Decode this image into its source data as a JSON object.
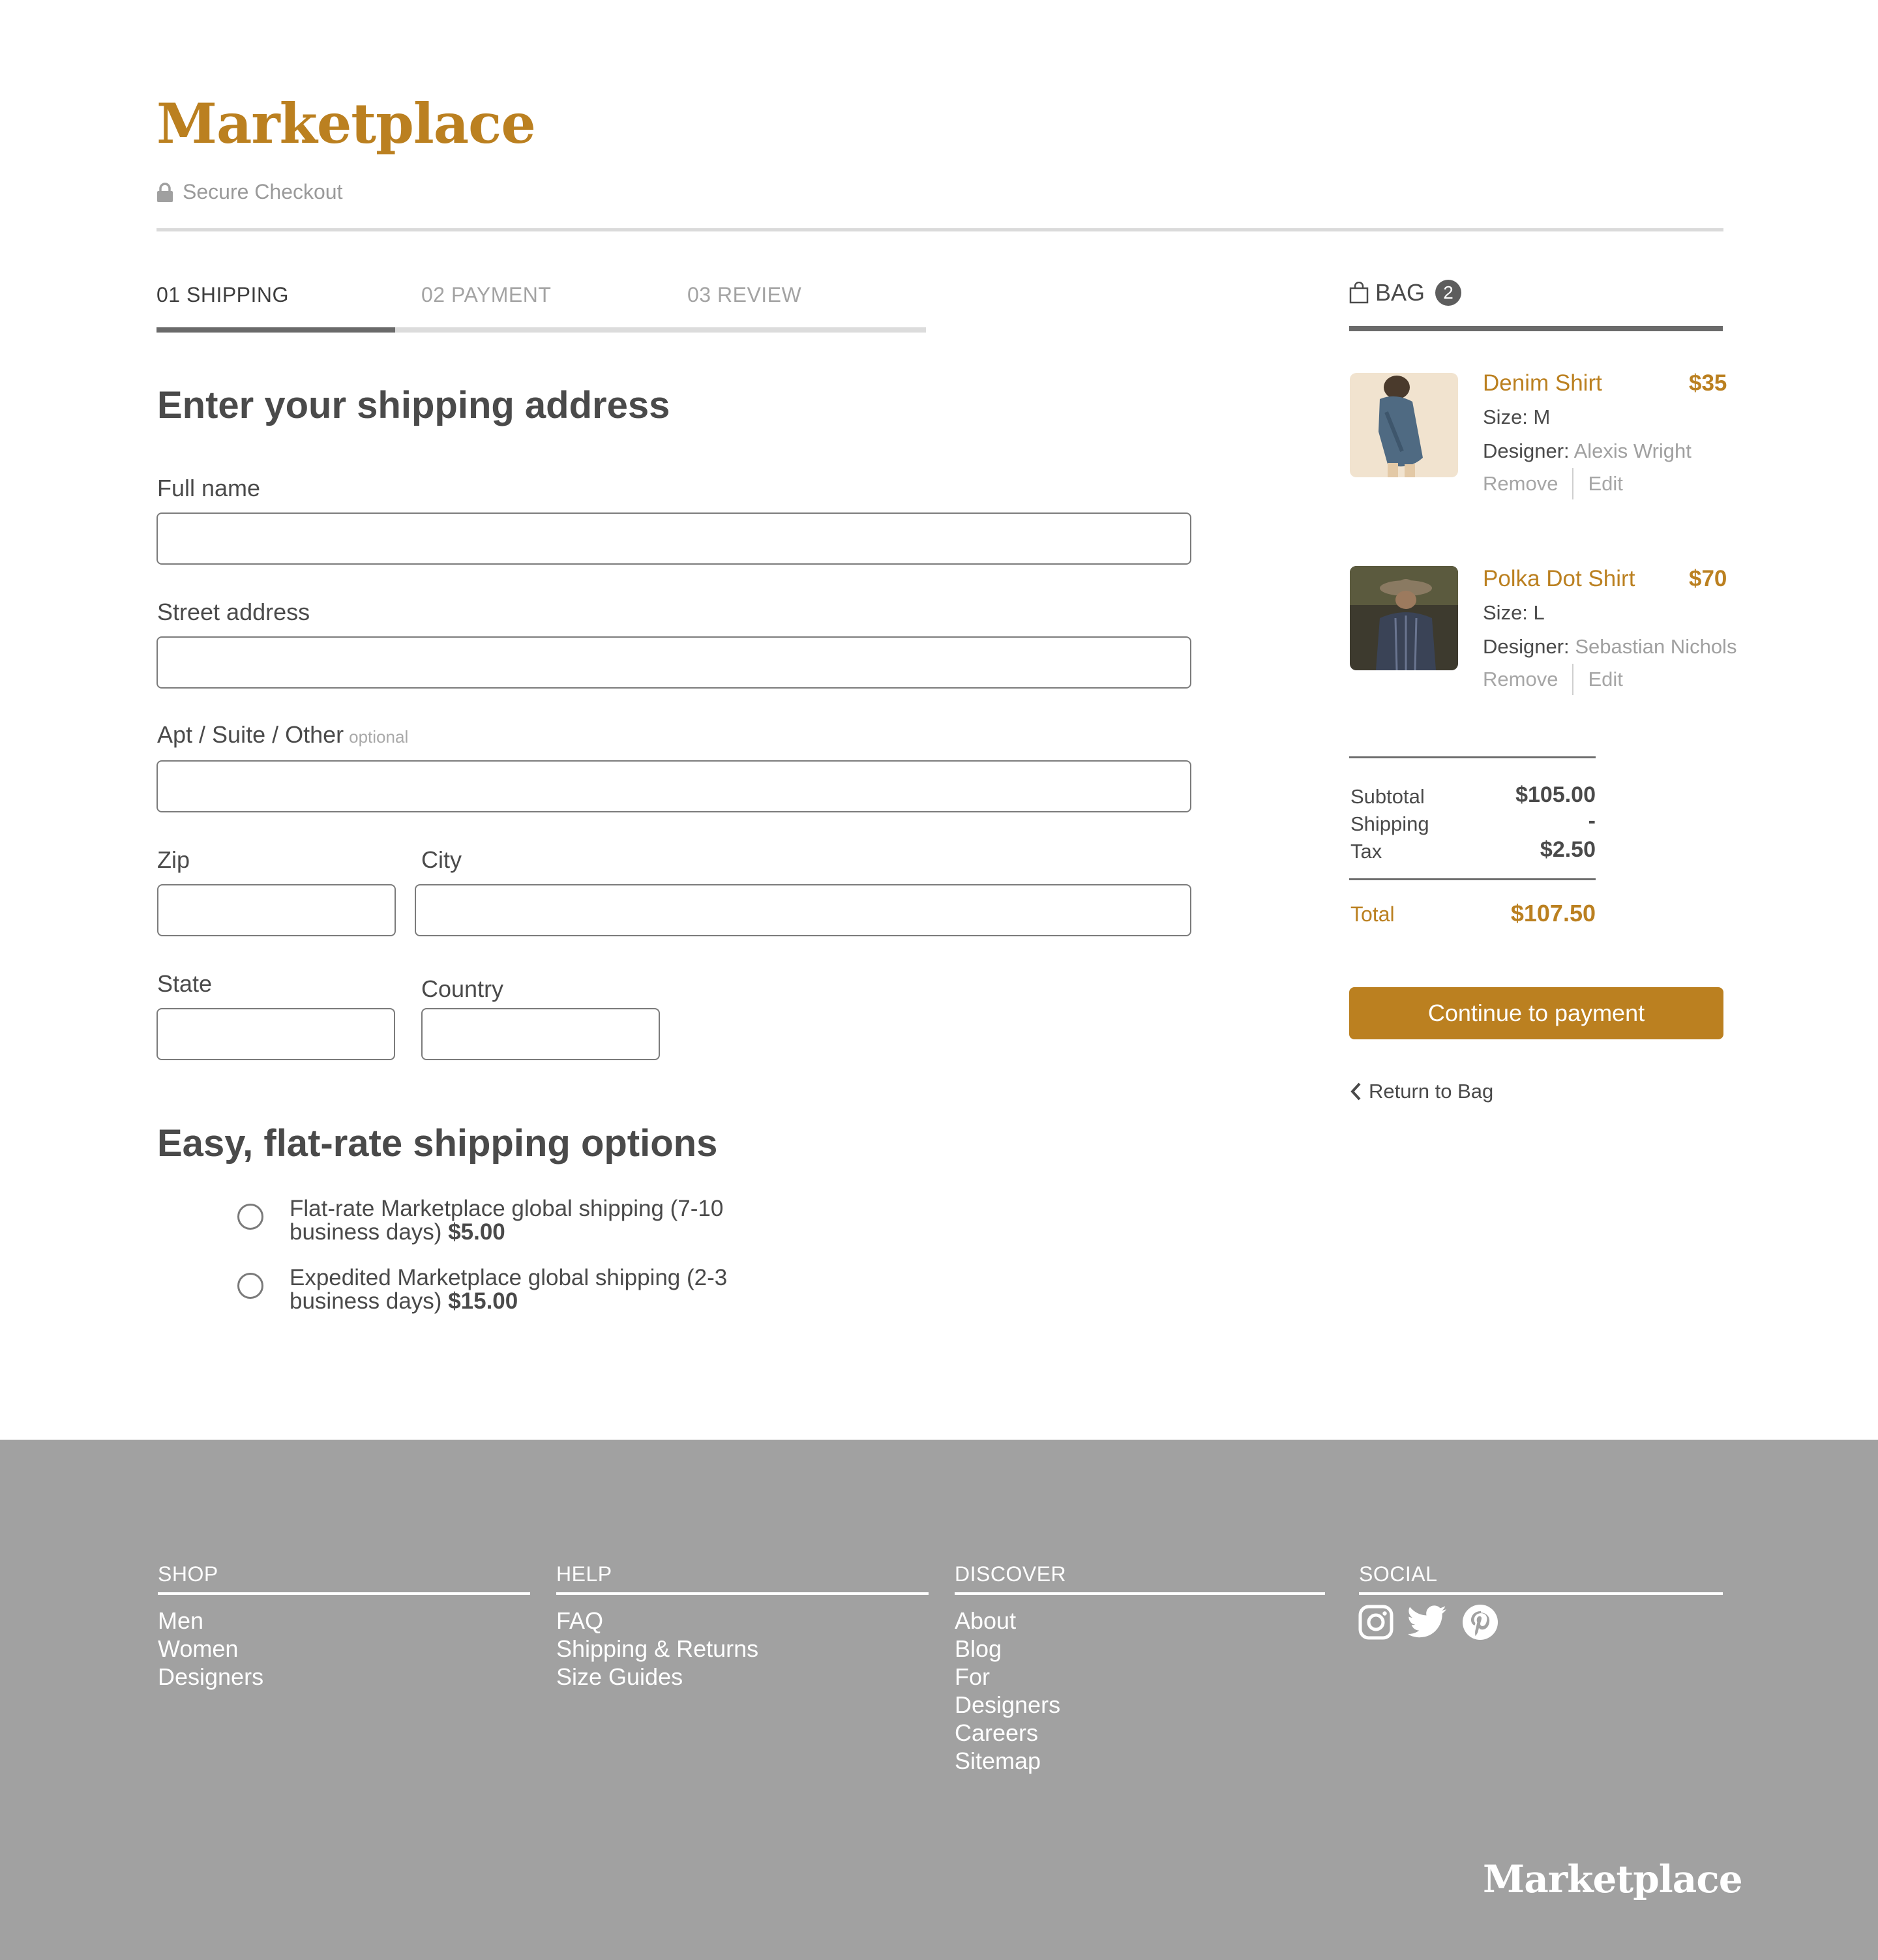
{
  "header": {
    "brand": "Marketplace",
    "secure_label": "Secure Checkout"
  },
  "steps": [
    {
      "label": "01 SHIPPING",
      "active": true
    },
    {
      "label": "02 PAYMENT",
      "active": false
    },
    {
      "label": "03 REVIEW",
      "active": false
    }
  ],
  "progress_fraction": 0.31,
  "shipping_form": {
    "title": "Enter your shipping address",
    "fields": {
      "full_name": {
        "label": "Full name",
        "value": ""
      },
      "street": {
        "label": "Street address",
        "value": ""
      },
      "apt": {
        "label": "Apt / Suite / Other",
        "hint": "optional",
        "value": ""
      },
      "zip": {
        "label": "Zip",
        "value": ""
      },
      "city": {
        "label": "City",
        "value": ""
      },
      "state": {
        "label": "State",
        "value": ""
      },
      "country": {
        "label": "Country",
        "value": ""
      }
    }
  },
  "shipping_options": {
    "title": "Easy, flat-rate shipping options",
    "options": [
      {
        "text": "Flat-rate Marketplace global shipping (7-10 business days)",
        "price": "$5.00",
        "selected": false
      },
      {
        "text": "Expedited Marketplace global shipping (2-3 business days)",
        "price": "$15.00",
        "selected": false
      }
    ]
  },
  "bag": {
    "label": "BAG",
    "count": "2",
    "items": [
      {
        "name": "Denim Shirt",
        "price": "$35",
        "size_label": "Size:",
        "size": "M",
        "designer_label": "Designer:",
        "designer": "Alexis Wright",
        "remove": "Remove",
        "edit": "Edit"
      },
      {
        "name": "Polka Dot Shirt",
        "price": "$70",
        "size_label": "Size:",
        "size": "L",
        "designer_label": "Designer:",
        "designer": "Sebastian Nichols",
        "remove": "Remove",
        "edit": "Edit"
      }
    ],
    "summary": {
      "subtotal_label": "Subtotal",
      "subtotal": "$105.00",
      "shipping_label": "Shipping",
      "shipping": "-",
      "tax_label": "Tax",
      "tax": "$2.50",
      "total_label": "Total",
      "total": "$107.50"
    },
    "cta": "Continue to payment",
    "return_label": "Return to Bag"
  },
  "footer": {
    "columns": [
      {
        "heading": "SHOP",
        "links": [
          "Men",
          "Women",
          "Designers"
        ]
      },
      {
        "heading": "HELP",
        "links": [
          "FAQ",
          "Shipping & Returns",
          "Size Guides"
        ]
      },
      {
        "heading": "DISCOVER",
        "links": [
          "About",
          "Blog",
          "For",
          "Designers",
          "Careers",
          "Sitemap"
        ]
      },
      {
        "heading": "SOCIAL",
        "links": []
      }
    ],
    "social_icons": [
      "instagram-icon",
      "twitter-icon",
      "pinterest-icon"
    ],
    "brand": "Marketplace"
  },
  "colors": {
    "accent": "#bb8020",
    "footer_bg": "#a1a1a1",
    "text": "#4a4a4a",
    "muted": "#a0a0a0"
  }
}
